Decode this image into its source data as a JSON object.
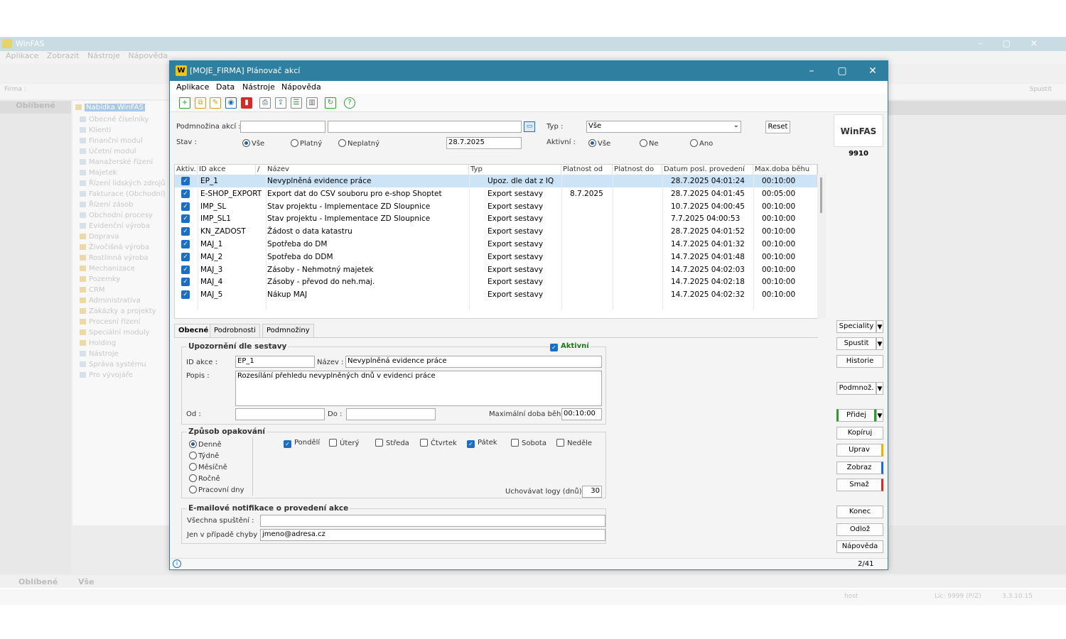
{
  "background_app": {
    "title": "WinFAS",
    "menu": [
      "Aplikace",
      "Zobrazit",
      "Nástroje",
      "Nápověda"
    ],
    "firm_label": "Firma :",
    "favorites_label": "Oblíbené",
    "tree_root": "Nabídka WinFAS",
    "tree_items": [
      "Obecné číselníky",
      "Klienti",
      "Finanční modul",
      "Účetní modul",
      "Manažerské řízení",
      "Majetek",
      "Řízení lidských zdrojů",
      "Fakturace (Obchodní)",
      "Řízení zásob",
      "Obchodní procesy",
      "Evidenční výroba",
      "Doprava",
      "Živočišná výroba",
      "Rostlinná výroba",
      "Mechanizace",
      "Pozemky",
      "CRM",
      "Administrativa",
      "Zakázky a projekty",
      "Procesní řízení",
      "Speciální moduly",
      "Holding",
      "Nástroje",
      "Správa systému",
      "Pro vývojáře"
    ],
    "bottom_tabs": [
      "Oblíbené",
      "Vše"
    ],
    "run_label": "Spustit",
    "status_user": "host",
    "status_lic": "Lic: 9999 (P/Z)",
    "status_version": "3.3.10.15"
  },
  "dialog": {
    "title": "[MOJE_FIRMA] Plánovač akcí",
    "menu": [
      "Aplikace",
      "Data",
      "Nástroje",
      "Nápověda"
    ],
    "filters": {
      "subset_label": "Podmnožina akcí :",
      "type_label": "Typ :",
      "type_value": "Vše",
      "reset_label": "Reset",
      "state_label": "Stav :",
      "state_options": [
        "Vše",
        "Platný",
        "Neplatný"
      ],
      "date_value": "28.7.2025",
      "active_label": "Aktivní :",
      "active_options": [
        "Vše",
        "Ne",
        "Ano"
      ]
    },
    "columns": [
      "Aktiv.",
      "ID akce",
      "/",
      "Název",
      "Typ",
      "Platnost od",
      "Platnost do",
      "Datum posl. provedení",
      "Max.doba běhu"
    ],
    "rows": [
      {
        "id": "EP_1",
        "name": "Nevyplněná evidence práce",
        "type": "Upoz. dle dat z IQ",
        "from": "",
        "to": "",
        "last": "28.7.2025 04:01:24",
        "max": "00:10:00"
      },
      {
        "id": "E-SHOP_EXPORT",
        "name": "Export dat do CSV souboru pro e-shop Shoptet",
        "type": "Export sestavy",
        "from": "8.7.2025",
        "to": "",
        "last": "28.7.2025 04:01:45",
        "max": "00:05:00"
      },
      {
        "id": "IMP_SL",
        "name": "Stav projektu - Implementace ZD Sloupnice",
        "type": "Export sestavy",
        "from": "",
        "to": "",
        "last": "10.7.2025 04:00:45",
        "max": "00:10:00"
      },
      {
        "id": "IMP_SL1",
        "name": "Stav projektu - Implementace ZD Sloupnice",
        "type": "Export sestavy",
        "from": "",
        "to": "",
        "last": "7.7.2025 04:00:53",
        "max": "00:10:00"
      },
      {
        "id": "KN_ZADOST",
        "name": "Žádost o data katastru",
        "type": "Export sestavy",
        "from": "",
        "to": "",
        "last": "28.7.2025 04:01:52",
        "max": "00:10:00"
      },
      {
        "id": "MAJ_1",
        "name": "Spotřeba do DM",
        "type": "Export sestavy",
        "from": "",
        "to": "",
        "last": "14.7.2025 04:01:32",
        "max": "00:10:00"
      },
      {
        "id": "MAJ_2",
        "name": "Spotřeba do DDM",
        "type": "Export sestavy",
        "from": "",
        "to": "",
        "last": "14.7.2025 04:01:48",
        "max": "00:10:00"
      },
      {
        "id": "MAJ_3",
        "name": "Zásoby - Nehmotný majetek",
        "type": "Export sestavy",
        "from": "",
        "to": "",
        "last": "14.7.2025 04:02:03",
        "max": "00:10:00"
      },
      {
        "id": "MAJ_4",
        "name": "Zásoby - převod do neh.maj.",
        "type": "Export sestavy",
        "from": "",
        "to": "",
        "last": "14.7.2025 04:02:18",
        "max": "00:10:00"
      },
      {
        "id": "MAJ_5",
        "name": "Nákup MAJ",
        "type": "Export sestavy",
        "from": "",
        "to": "",
        "last": "14.7.2025 04:02:32",
        "max": "00:10:00"
      }
    ],
    "tabs": [
      "Obecné",
      "Podrobnosti",
      "Podmnožiny"
    ],
    "detail": {
      "group1_title": "Upozornění dle sestavy",
      "active_label": "Aktivní",
      "id_label": "ID akce :",
      "id_value": "EP_1",
      "name_label": "Název :",
      "name_value": "Nevyplněná evidence práce",
      "desc_label": "Popis :",
      "desc_value": "Rozesílání přehledu nevyplněných dnů v evidenci práce",
      "from_label": "Od :",
      "to_label": "Do :",
      "max_label": "Maximální doba běhu :",
      "max_value": "00:10:00",
      "group2_title": "Způsob opakování",
      "repeat_options": [
        "Denně",
        "Týdně",
        "Měsíčně",
        "Ročně",
        "Pracovní dny"
      ],
      "days": [
        {
          "label": "Pondělí",
          "on": true
        },
        {
          "label": "Úterý",
          "on": false
        },
        {
          "label": "Středa",
          "on": false
        },
        {
          "label": "Čtvrtek",
          "on": false
        },
        {
          "label": "Pátek",
          "on": true
        },
        {
          "label": "Sobota",
          "on": false
        },
        {
          "label": "Neděle",
          "on": false
        }
      ],
      "logs_label": "Uchovávat logy (dnů) :",
      "logs_value": "30",
      "group3_title": "E-mailové notifikace o provedení akce",
      "all_label": "Všechna spuštění :",
      "all_value": "",
      "err_label": "Jen v případě chyby :",
      "err_value": "jmeno@adresa.cz"
    },
    "right_panel": {
      "logo": "WinFAS",
      "number": "9910",
      "buttons": [
        "Speciality",
        "Spustit",
        "Historie",
        "Podmnož.",
        "Přidej",
        "Kopíruj",
        "Uprav",
        "Zobraz",
        "Smaž",
        "Konec",
        "Odlož",
        "Nápověda"
      ]
    },
    "status": {
      "info_icon": "i",
      "count": "2/41"
    }
  },
  "colors": {
    "title_bar": "#2e7fa0",
    "selected_row": "#cde4f7",
    "checkbox": "#1a6fc4"
  }
}
